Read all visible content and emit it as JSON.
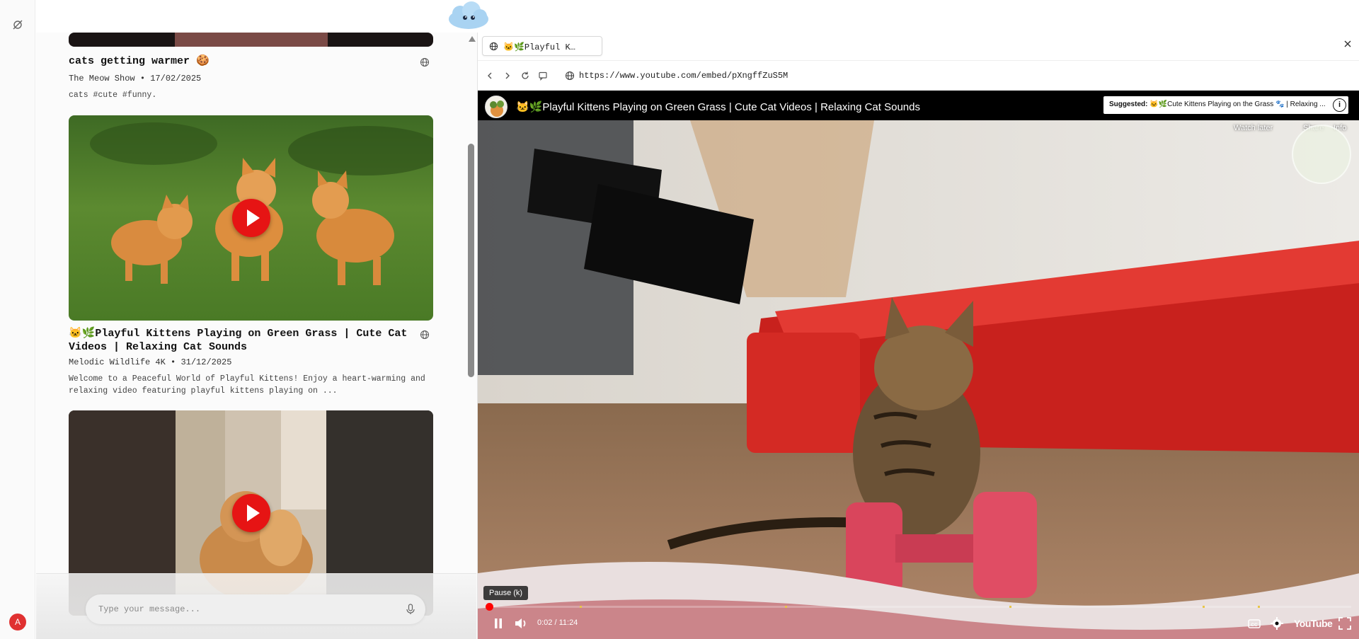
{
  "user": {
    "avatar_letter": "A"
  },
  "feed": {
    "cards": [
      {
        "title": "cats getting warmer 🍪",
        "channel": "The Meow Show",
        "date": "17/02/2025",
        "description": "cats #cute #funny."
      },
      {
        "title": "🐱🌿Playful Kittens Playing on Green Grass | Cute Cat Videos | Relaxing Cat Sounds",
        "channel": "Melodic Wildlife 4K",
        "date": "31/12/2025",
        "description": "Welcome to a Peaceful World of Playful Kittens! Enjoy a heart-warming and relaxing video featuring playful kittens playing on ..."
      }
    ],
    "meta_separator": "•"
  },
  "composer": {
    "placeholder": "Type your message..."
  },
  "browser": {
    "tab_label": "🐱🌿Playful K…",
    "url": "https://www.youtube.com/embed/pXngffZuS5M"
  },
  "player": {
    "title": "🐱🌿Playful Kittens Playing on Green Grass | Cute Cat Videos | Relaxing Cat Sounds",
    "suggested_label": "Suggested:",
    "suggested_text": "🐱🌿Cute Kittens Playing on the Grass 🐾 | Relaxing ...",
    "info_glyph": "i",
    "actions": {
      "watch_later": "Watch later",
      "share": "Share",
      "info": "Info"
    },
    "tooltip": "Pause (k)",
    "current_time": "0:02",
    "duration": "11:24",
    "progress_fraction": 0.003,
    "brand": "YouTube"
  },
  "colors": {
    "accent_red": "#ff0000",
    "play_red": "#e61414"
  }
}
